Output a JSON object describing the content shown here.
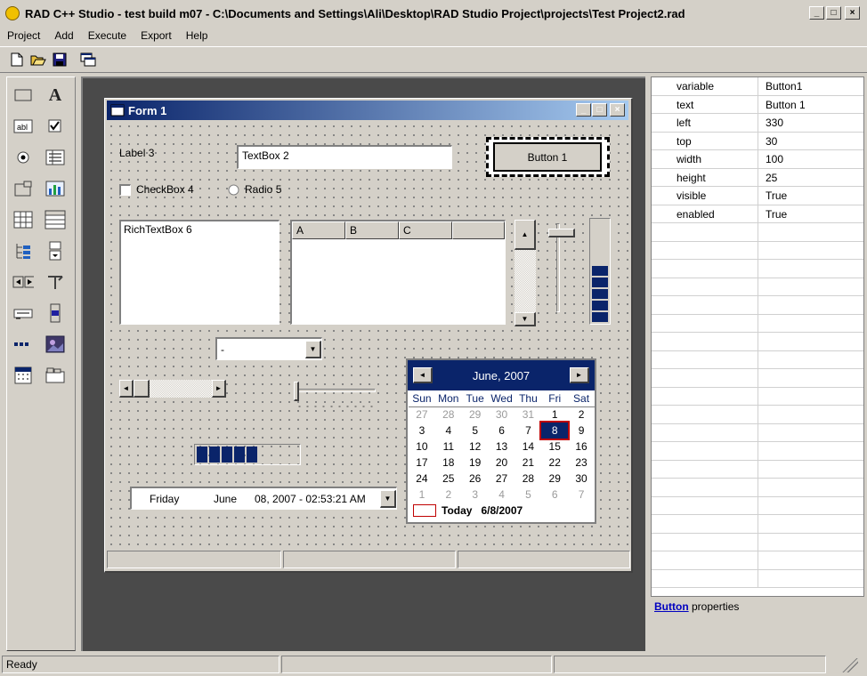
{
  "window": {
    "title": "RAD C++ Studio - test build m07 - C:\\Documents and Settings\\Ali\\Desktop\\RAD Studio Project\\projects\\Test Project2.rad",
    "controls": {
      "minimize": "_",
      "maximize": "□",
      "close": "×"
    }
  },
  "menu": {
    "items": [
      "Project",
      "Add",
      "Execute",
      "Export",
      "Help"
    ]
  },
  "toolbar": {
    "icons": [
      "new-file-icon",
      "open-folder-icon",
      "save-icon",
      "run-window-icon"
    ]
  },
  "toolbox": {
    "icons": [
      "panel-icon",
      "label-text-icon",
      "textbox-icon",
      "checkbox-icon",
      "radio-icon",
      "list-icon",
      "frame-icon",
      "chart-icon",
      "grid-icon",
      "table-icon",
      "tree-icon",
      "combo-icon",
      "spin-icon",
      "split-icon",
      "scroll-icon",
      "vscroll-icon",
      "progress-icon",
      "image-icon",
      "calendar-icon",
      "tab-icon"
    ]
  },
  "form": {
    "title": "Form 1",
    "label3": "Label 3",
    "textbox2": "TextBox 2",
    "button1": "Button 1",
    "checkbox4": "CheckBox 4",
    "radio5": "Radio 5",
    "richtext6": "RichTextBox 6",
    "listview_cols": [
      "A",
      "B",
      "C"
    ],
    "combo_value": "-",
    "progress_blocks": 5,
    "vprogress_blocks": 5,
    "datetime": {
      "day": "Friday",
      "month": "June",
      "rest": "08, 2007 - 02:53:21 AM"
    },
    "calendar": {
      "header": "June, 2007",
      "weekdays": [
        "Sun",
        "Mon",
        "Tue",
        "Wed",
        "Thu",
        "Fri",
        "Sat"
      ],
      "weeks": [
        [
          "27",
          "28",
          "29",
          "30",
          "31",
          "1",
          "2"
        ],
        [
          "3",
          "4",
          "5",
          "6",
          "7",
          "8",
          "9"
        ],
        [
          "10",
          "11",
          "12",
          "13",
          "14",
          "15",
          "16"
        ],
        [
          "17",
          "18",
          "19",
          "20",
          "21",
          "22",
          "23"
        ],
        [
          "24",
          "25",
          "26",
          "27",
          "28",
          "29",
          "30"
        ],
        [
          "1",
          "2",
          "3",
          "4",
          "5",
          "6",
          "7"
        ]
      ],
      "selected": "8",
      "today_label": "Today",
      "today_date": "6/8/2007"
    }
  },
  "properties": {
    "rows": [
      {
        "key": "variable",
        "value": "Button1"
      },
      {
        "key": "text",
        "value": "Button 1"
      },
      {
        "key": "left",
        "value": "330"
      },
      {
        "key": "top",
        "value": "30"
      },
      {
        "key": "width",
        "value": "100"
      },
      {
        "key": "height",
        "value": "25"
      },
      {
        "key": "visible",
        "value": "True"
      },
      {
        "key": "enabled",
        "value": "True"
      }
    ],
    "footer_link": "Button",
    "footer_text": "properties"
  },
  "status": {
    "text": "Ready"
  },
  "colors": {
    "title_dark": "#0a246a",
    "title_light": "#a6caf0",
    "calendar_header": "#0a246a",
    "progress": "#0a246a"
  }
}
